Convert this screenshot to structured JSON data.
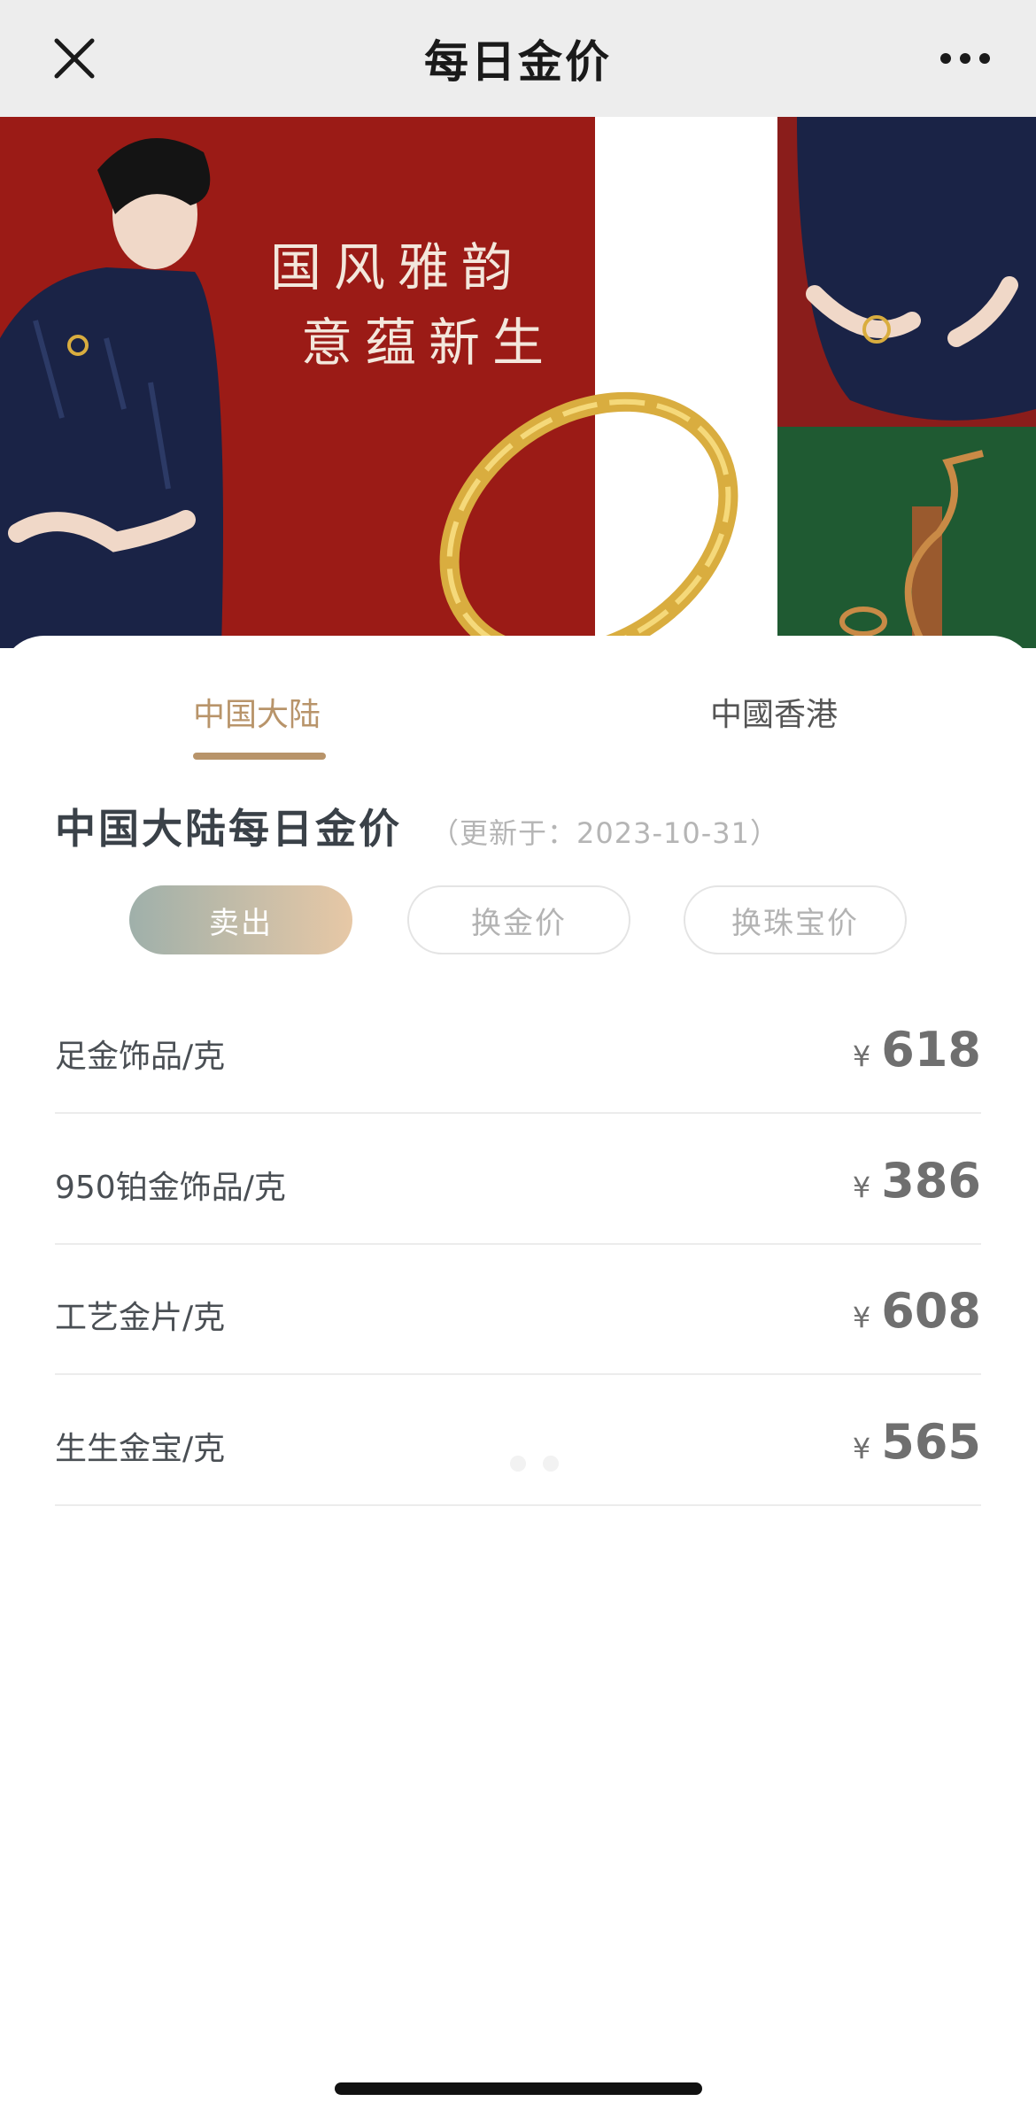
{
  "navbar": {
    "title": "每日金价",
    "close_icon": "close-icon",
    "more_icon": "more-icon"
  },
  "banner": {
    "headline_line1": "国风雅韵",
    "headline_line2": "意蕴新生",
    "colors": {
      "red": "#9b1b16",
      "navy": "#1a2346",
      "green": "#1f5a32",
      "gold": "#d9ad3f"
    }
  },
  "tabs": [
    {
      "label": "中国大陆",
      "active": true
    },
    {
      "label": "中國香港",
      "active": false
    }
  ],
  "section": {
    "title": "中国大陆每日金价",
    "updated": "（更新于：2023-10-31）"
  },
  "pills": [
    {
      "label": "卖出",
      "selected": true
    },
    {
      "label": "换金价",
      "selected": false
    },
    {
      "label": "换珠宝价",
      "selected": false
    }
  ],
  "prices": [
    {
      "label": "足金饰品/克",
      "currency": "¥",
      "value": "618"
    },
    {
      "label": "950铂金饰品/克",
      "currency": "¥",
      "value": "386"
    },
    {
      "label": "工艺金片/克",
      "currency": "¥",
      "value": "608"
    },
    {
      "label": "生生金宝/克",
      "currency": "¥",
      "value": "565"
    }
  ],
  "colors": {
    "accent": "#b8946a",
    "nav_bg": "#ededed",
    "title_text": "#3a4148",
    "price_text": "#6f6f6f"
  }
}
